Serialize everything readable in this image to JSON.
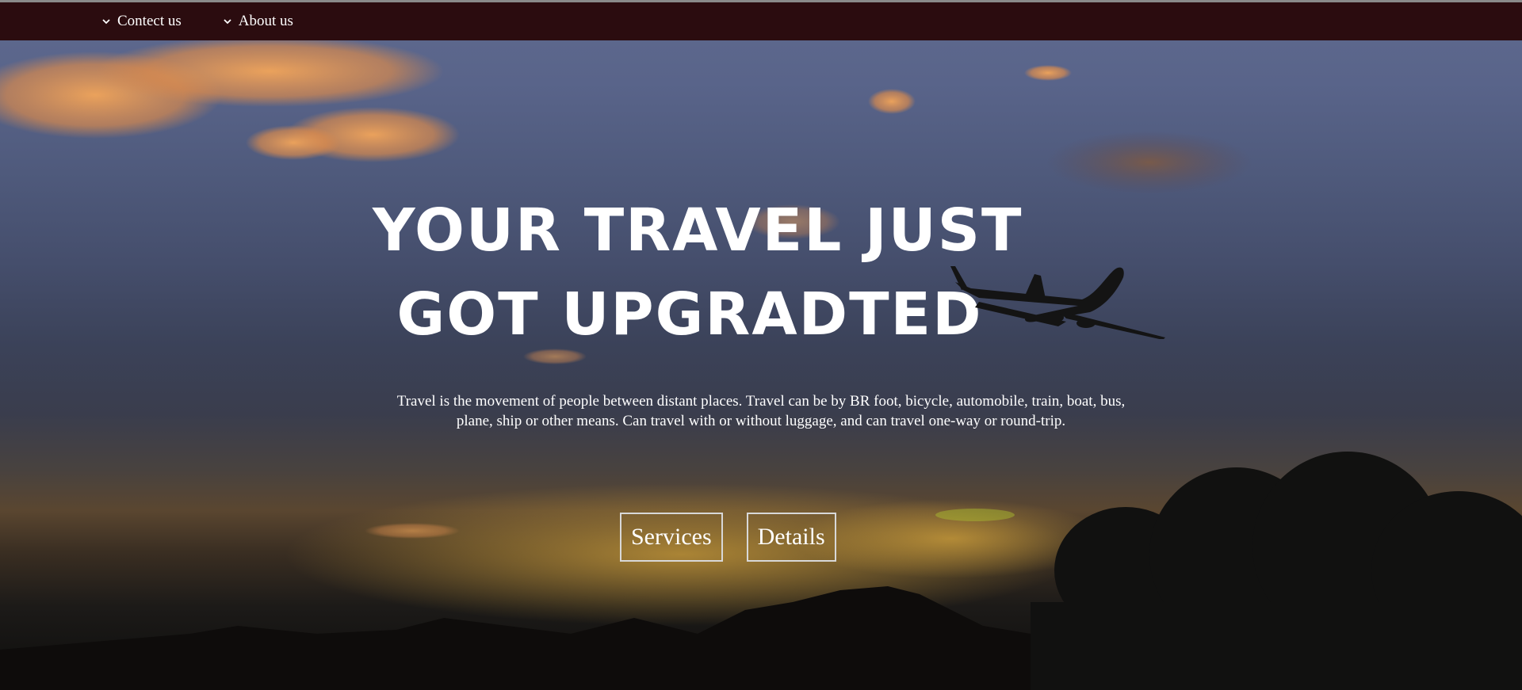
{
  "nav": {
    "items": [
      {
        "label": "Contect us",
        "icon": "chevron-down-icon"
      },
      {
        "label": "About us",
        "icon": "chevron-down-icon"
      }
    ]
  },
  "hero": {
    "headline_line1": "YOUR TRAVEL JUST",
    "headline_line2": "GOT UPGRADTED",
    "description": "Travel is the movement of people between distant places. Travel can be by BR foot, bicycle, automobile, train, boat, bus, plane, ship or other means. Can travel with or without luggage, and can travel one-way or round-trip.",
    "buttons": {
      "services": "Services",
      "details": "Details"
    }
  },
  "colors": {
    "navbar": "#2b0c0f",
    "text": "#ffffff",
    "button_border": "#d8d8d8"
  }
}
